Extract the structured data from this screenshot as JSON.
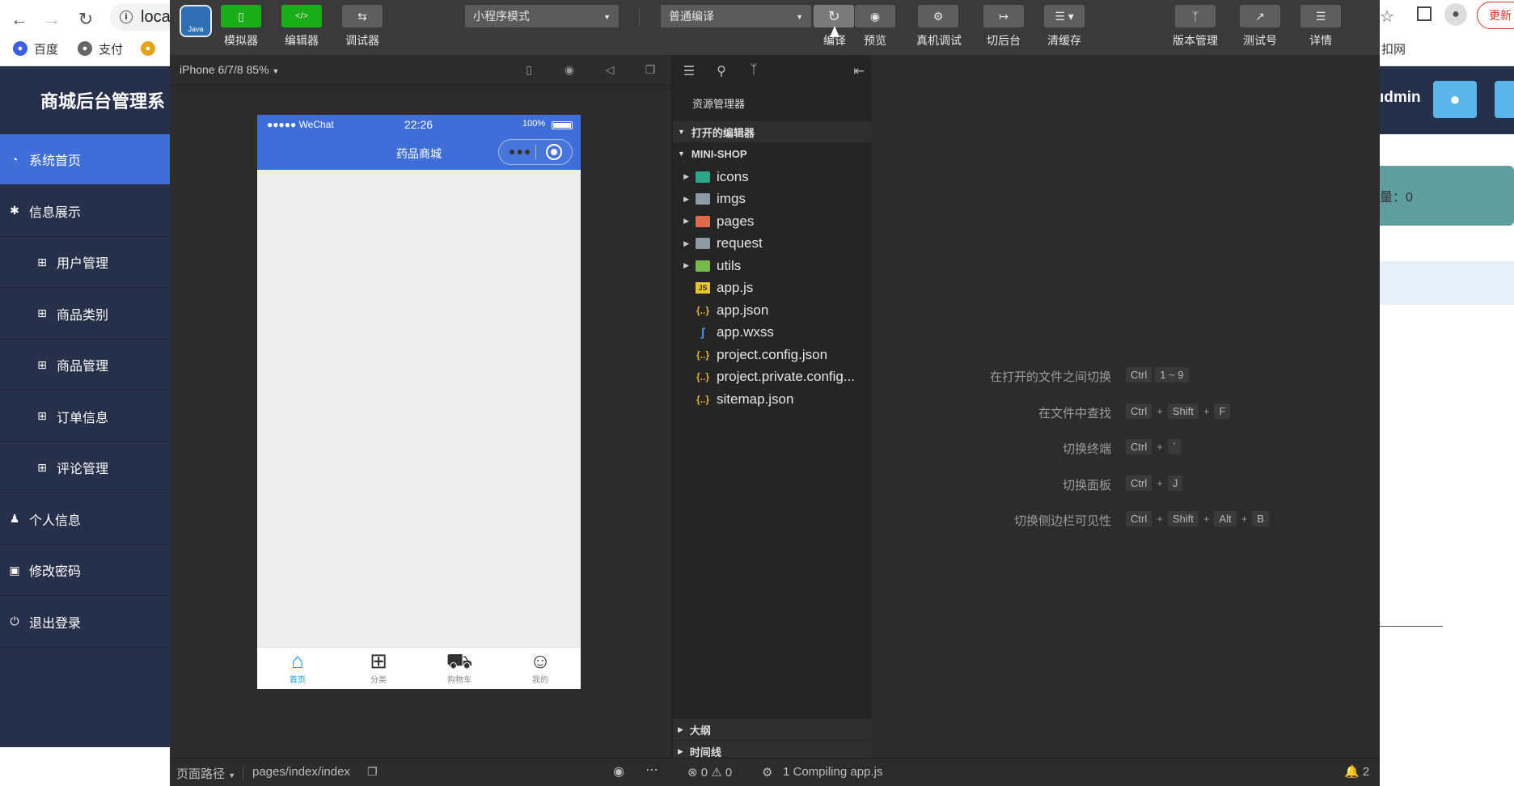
{
  "browser": {
    "address": "loca",
    "bookmarks": [
      "百度",
      "支付"
    ],
    "update_label": "更新",
    "right_tail": "ıdmin",
    "right_hint": "扣网"
  },
  "admin": {
    "title": "商城后台管理系",
    "menu": [
      {
        "label": "系统首页",
        "icon": "dashboard-icon",
        "active": true
      },
      {
        "label": "信息展示",
        "icon": "asterisk-icon"
      },
      {
        "label": "用户管理",
        "icon": "table-icon",
        "sub": true
      },
      {
        "label": "商品类别",
        "icon": "table-icon",
        "sub": true
      },
      {
        "label": "商品管理",
        "icon": "table-icon",
        "sub": true
      },
      {
        "label": "订单信息",
        "icon": "table-icon",
        "sub": true
      },
      {
        "label": "评论管理",
        "icon": "table-icon",
        "sub": true
      },
      {
        "label": "个人信息",
        "icon": "user-icon"
      },
      {
        "label": "修改密码",
        "icon": "lock-icon"
      },
      {
        "label": "退出登录",
        "icon": "power-icon"
      }
    ],
    "count_text": "量：0"
  },
  "toolbar": {
    "simulator": "模拟器",
    "editor": "编辑器",
    "debugger": "调试器",
    "mode_select": "小程序模式",
    "compile_select": "普通编译",
    "compile": "编译",
    "preview": "预览",
    "remote_debug": "真机调试",
    "background": "切后台",
    "clear_cache": "清缓存",
    "version": "版本管理",
    "test": "测试号",
    "details": "详情"
  },
  "simulator": {
    "device": "iPhone 6/7/8 85%",
    "carrier": "●●●●● WeChat",
    "time": "22:26",
    "battery": "100%",
    "page_title": "药品商城",
    "tabs": [
      {
        "label": "首页",
        "icon": "home-icon",
        "active": true
      },
      {
        "label": "分类",
        "icon": "grid-icon"
      },
      {
        "label": "购物车",
        "icon": "cart-icon"
      },
      {
        "label": "我的",
        "icon": "person-icon"
      }
    ]
  },
  "explorer": {
    "title": "资源管理器",
    "open_editors": "打开的编辑器",
    "project": "MINI-SHOP",
    "files": [
      {
        "name": "icons",
        "type": "folder",
        "color": "#2fa58a"
      },
      {
        "name": "imgs",
        "type": "folder",
        "color": "#8f9aa7"
      },
      {
        "name": "pages",
        "type": "folder",
        "color": "#e06a4b"
      },
      {
        "name": "request",
        "type": "folder",
        "color": "#8f9aa7"
      },
      {
        "name": "utils",
        "type": "folder",
        "color": "#79b94a"
      },
      {
        "name": "app.js",
        "type": "js"
      },
      {
        "name": "app.json",
        "type": "json"
      },
      {
        "name": "app.wxss",
        "type": "css"
      },
      {
        "name": "project.config.json",
        "type": "json"
      },
      {
        "name": "project.private.config...",
        "type": "json"
      },
      {
        "name": "sitemap.json",
        "type": "json"
      }
    ],
    "outline": "大纲",
    "timeline": "时间线"
  },
  "shortcuts": [
    {
      "label": "在打开的文件之间切换",
      "keys": [
        "Ctrl",
        "1 ~ 9"
      ],
      "joined": false
    },
    {
      "label": "在文件中查找",
      "keys": [
        "Ctrl",
        "Shift",
        "F"
      ],
      "joined": true
    },
    {
      "label": "切换终端",
      "keys": [
        "Ctrl",
        "`"
      ],
      "joined": true
    },
    {
      "label": "切换面板",
      "keys": [
        "Ctrl",
        "J"
      ],
      "joined": true
    },
    {
      "label": "切换侧边栏可见性",
      "keys": [
        "Ctrl",
        "Shift",
        "Alt",
        "B"
      ],
      "joined": true
    }
  ],
  "status": {
    "page_path_label": "页面路径",
    "page_path": "pages/index/index",
    "errors": "0",
    "warnings": "0",
    "compiling": "1 Compiling app.js",
    "notifications": "2"
  },
  "colors": {
    "accent": "#3f6ed8",
    "admin_sidebar": "#27304a",
    "wechat_green": "#1aad19",
    "tab_active": "#1296db"
  }
}
